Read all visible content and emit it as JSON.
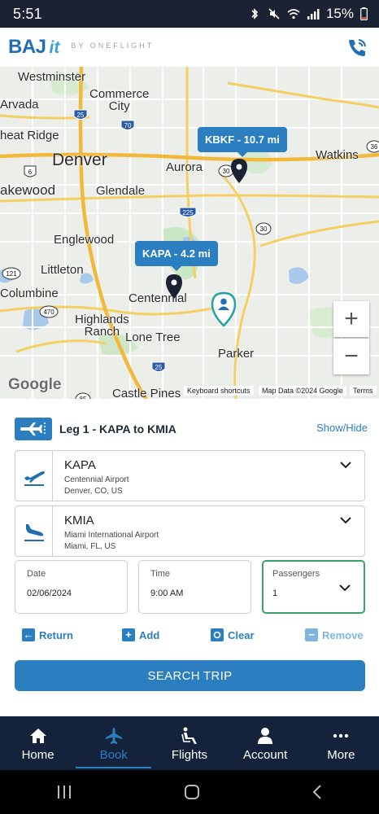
{
  "status_bar": {
    "time": "5:51",
    "battery": "15%"
  },
  "header": {
    "logo_main": "BAJ",
    "logo_it": "it",
    "logo_by": "BY ONEFLIGHT",
    "phone_icon": "phone-icon"
  },
  "map": {
    "cities": {
      "westminster": "Westminster",
      "commerce_city": "Commerce\nCity",
      "arvada": "Arvada",
      "wheat_ridge": "heat Ridge",
      "denver": "Denver",
      "aurora": "Aurora",
      "watkins": "Watkins",
      "lakewood": "akewood",
      "glendale": "Glendale",
      "englewood": "Englewood",
      "littleton": "Littleton",
      "columbine": "Columbine",
      "centennial": "Centennial",
      "highlands_ranch": "Highlands\nRanch",
      "lone_tree": "Lone Tree",
      "parker": "Parker",
      "castle_pines": "Castle Pines"
    },
    "shields": {
      "i25_top": "25",
      "i70": "70",
      "r6": "6",
      "r121": "121",
      "r470": "470",
      "r30a": "30",
      "r30b": "30",
      "r36": "36",
      "i225": "225",
      "i25_bot": "25",
      "r85": "85"
    },
    "callout_kbkf": "KBKF - 10.7 mi",
    "callout_kapa": "KAPA - 4.2 mi",
    "zoom_in": "+",
    "zoom_out": "−",
    "google": "Google",
    "footer_shortcuts": "Keyboard shortcuts",
    "footer_data": "Map Data ©2024 Google",
    "footer_terms": "Terms"
  },
  "leg": {
    "title": "Leg 1 - KAPA to KMIA",
    "show_hide": "Show/Hide",
    "departure": {
      "code": "KAPA",
      "name": "Centennial Airport",
      "location": "Denver, CO, US"
    },
    "arrival": {
      "code": "KMIA",
      "name": "Miami International Airport",
      "location": "Miami, FL, US"
    },
    "date": {
      "label": "Date",
      "value": "02/06/2024"
    },
    "time": {
      "label": "Time",
      "value": "9:00 AM"
    },
    "passengers": {
      "label": "Passengers",
      "value": "1"
    }
  },
  "actions": {
    "return": "Return",
    "add": "Add",
    "clear": "Clear",
    "remove": "Remove"
  },
  "search_button": "SEARCH TRIP",
  "bottom_nav": [
    {
      "label": "Home",
      "icon": "home-icon"
    },
    {
      "label": "Book",
      "icon": "airplane-icon",
      "active": true
    },
    {
      "label": "Flights",
      "icon": "seat-icon"
    },
    {
      "label": "Account",
      "icon": "person-icon"
    },
    {
      "label": "More",
      "icon": "more-icon"
    }
  ],
  "colors": {
    "primary": "#2b7fc0",
    "nav_bg": "#14233b",
    "active_border": "#3aa16a"
  }
}
